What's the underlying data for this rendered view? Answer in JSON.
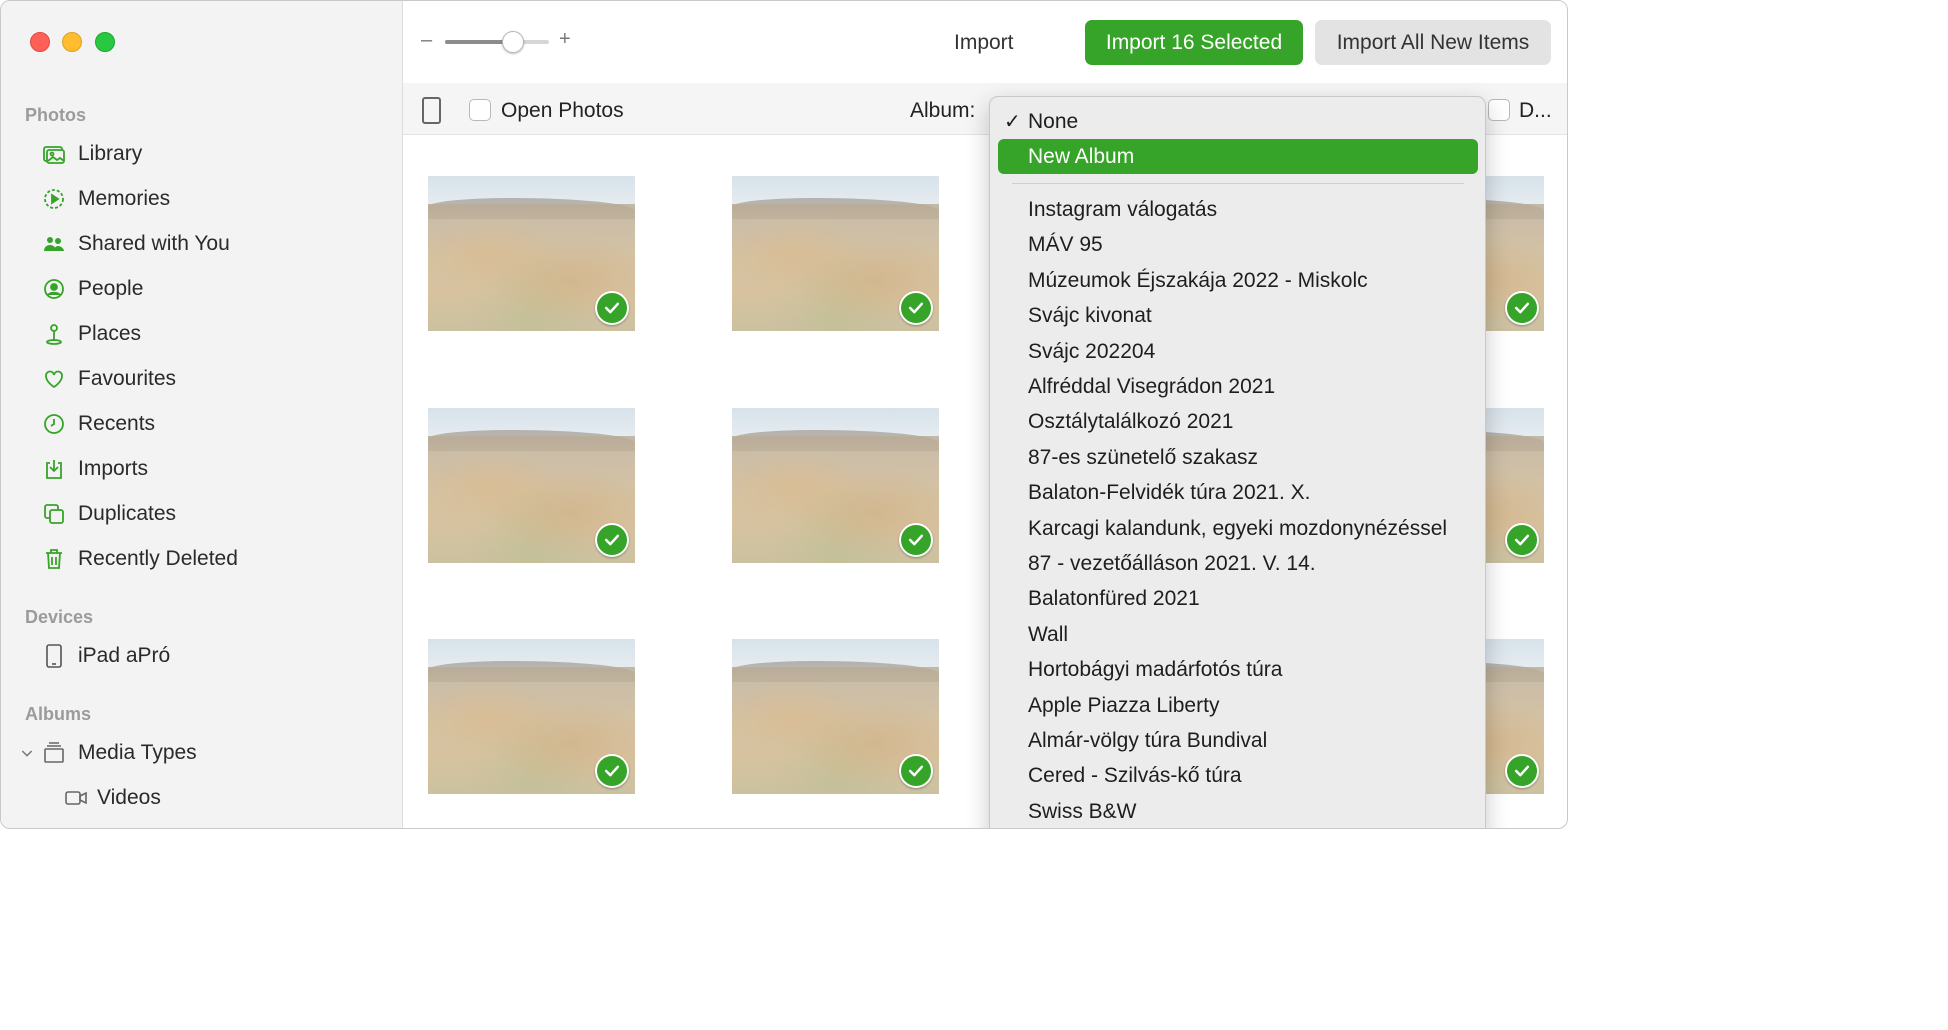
{
  "sidebar": {
    "sections": {
      "photos": "Photos",
      "devices": "Devices",
      "albums": "Albums"
    },
    "items": [
      {
        "label": "Library",
        "icon": "library-icon"
      },
      {
        "label": "Memories",
        "icon": "memories-icon"
      },
      {
        "label": "Shared with You",
        "icon": "shared-with-you-icon"
      },
      {
        "label": "People",
        "icon": "people-icon"
      },
      {
        "label": "Places",
        "icon": "places-icon"
      },
      {
        "label": "Favourites",
        "icon": "heart-icon"
      },
      {
        "label": "Recents",
        "icon": "clock-icon"
      },
      {
        "label": "Imports",
        "icon": "imports-icon"
      },
      {
        "label": "Duplicates",
        "icon": "duplicates-icon"
      },
      {
        "label": "Recently Deleted",
        "icon": "trash-icon"
      }
    ],
    "device": {
      "label": "iPad aPró",
      "icon": "ipad-icon"
    },
    "albums": [
      {
        "label": "Media Types",
        "icon": "media-types-icon"
      },
      {
        "label": "Videos",
        "icon": "video-icon"
      }
    ]
  },
  "toolbar": {
    "zoom_minus": "–",
    "zoom_plus": "+",
    "zoom_level": 0.65,
    "title": "Import",
    "import_selected_label": "Import 16 Selected",
    "import_all_label": "Import All New Items"
  },
  "options": {
    "open_photos_label": "Open Photos",
    "album_label": "Album:",
    "delete_label": "D..."
  },
  "dropdown": {
    "selected": "None",
    "check_glyph": "✓",
    "highlighted": "New Album",
    "items": [
      "Instagram válogatás",
      "MÁV 95",
      "Múzeumok Éjszakája 2022 - Miskolc",
      "Svájc kivonat",
      "Svájc 202204",
      "Alfréddal Visegrádon 2021",
      "Osztálytalálkozó 2021",
      "87-es szünetelő szakasz",
      "Balaton-Felvidék túra 2021. X.",
      "Karcagi kalandunk, egyeki mozdonynézéssel",
      "87 - vezetőálláson 2021. V. 14.",
      "Balatonfüred 2021",
      "Wall",
      "Hortobágyi madárfotós túra",
      "Apple Piazza Liberty",
      "Almár-völgy túra Bundival",
      "Cered - Szilvás-kő túra",
      "Swiss B&W"
    ]
  },
  "colors": {
    "accent": "#36a428",
    "close": "#fe5f57",
    "minimize": "#febc2e",
    "maximize": "#28c840"
  }
}
